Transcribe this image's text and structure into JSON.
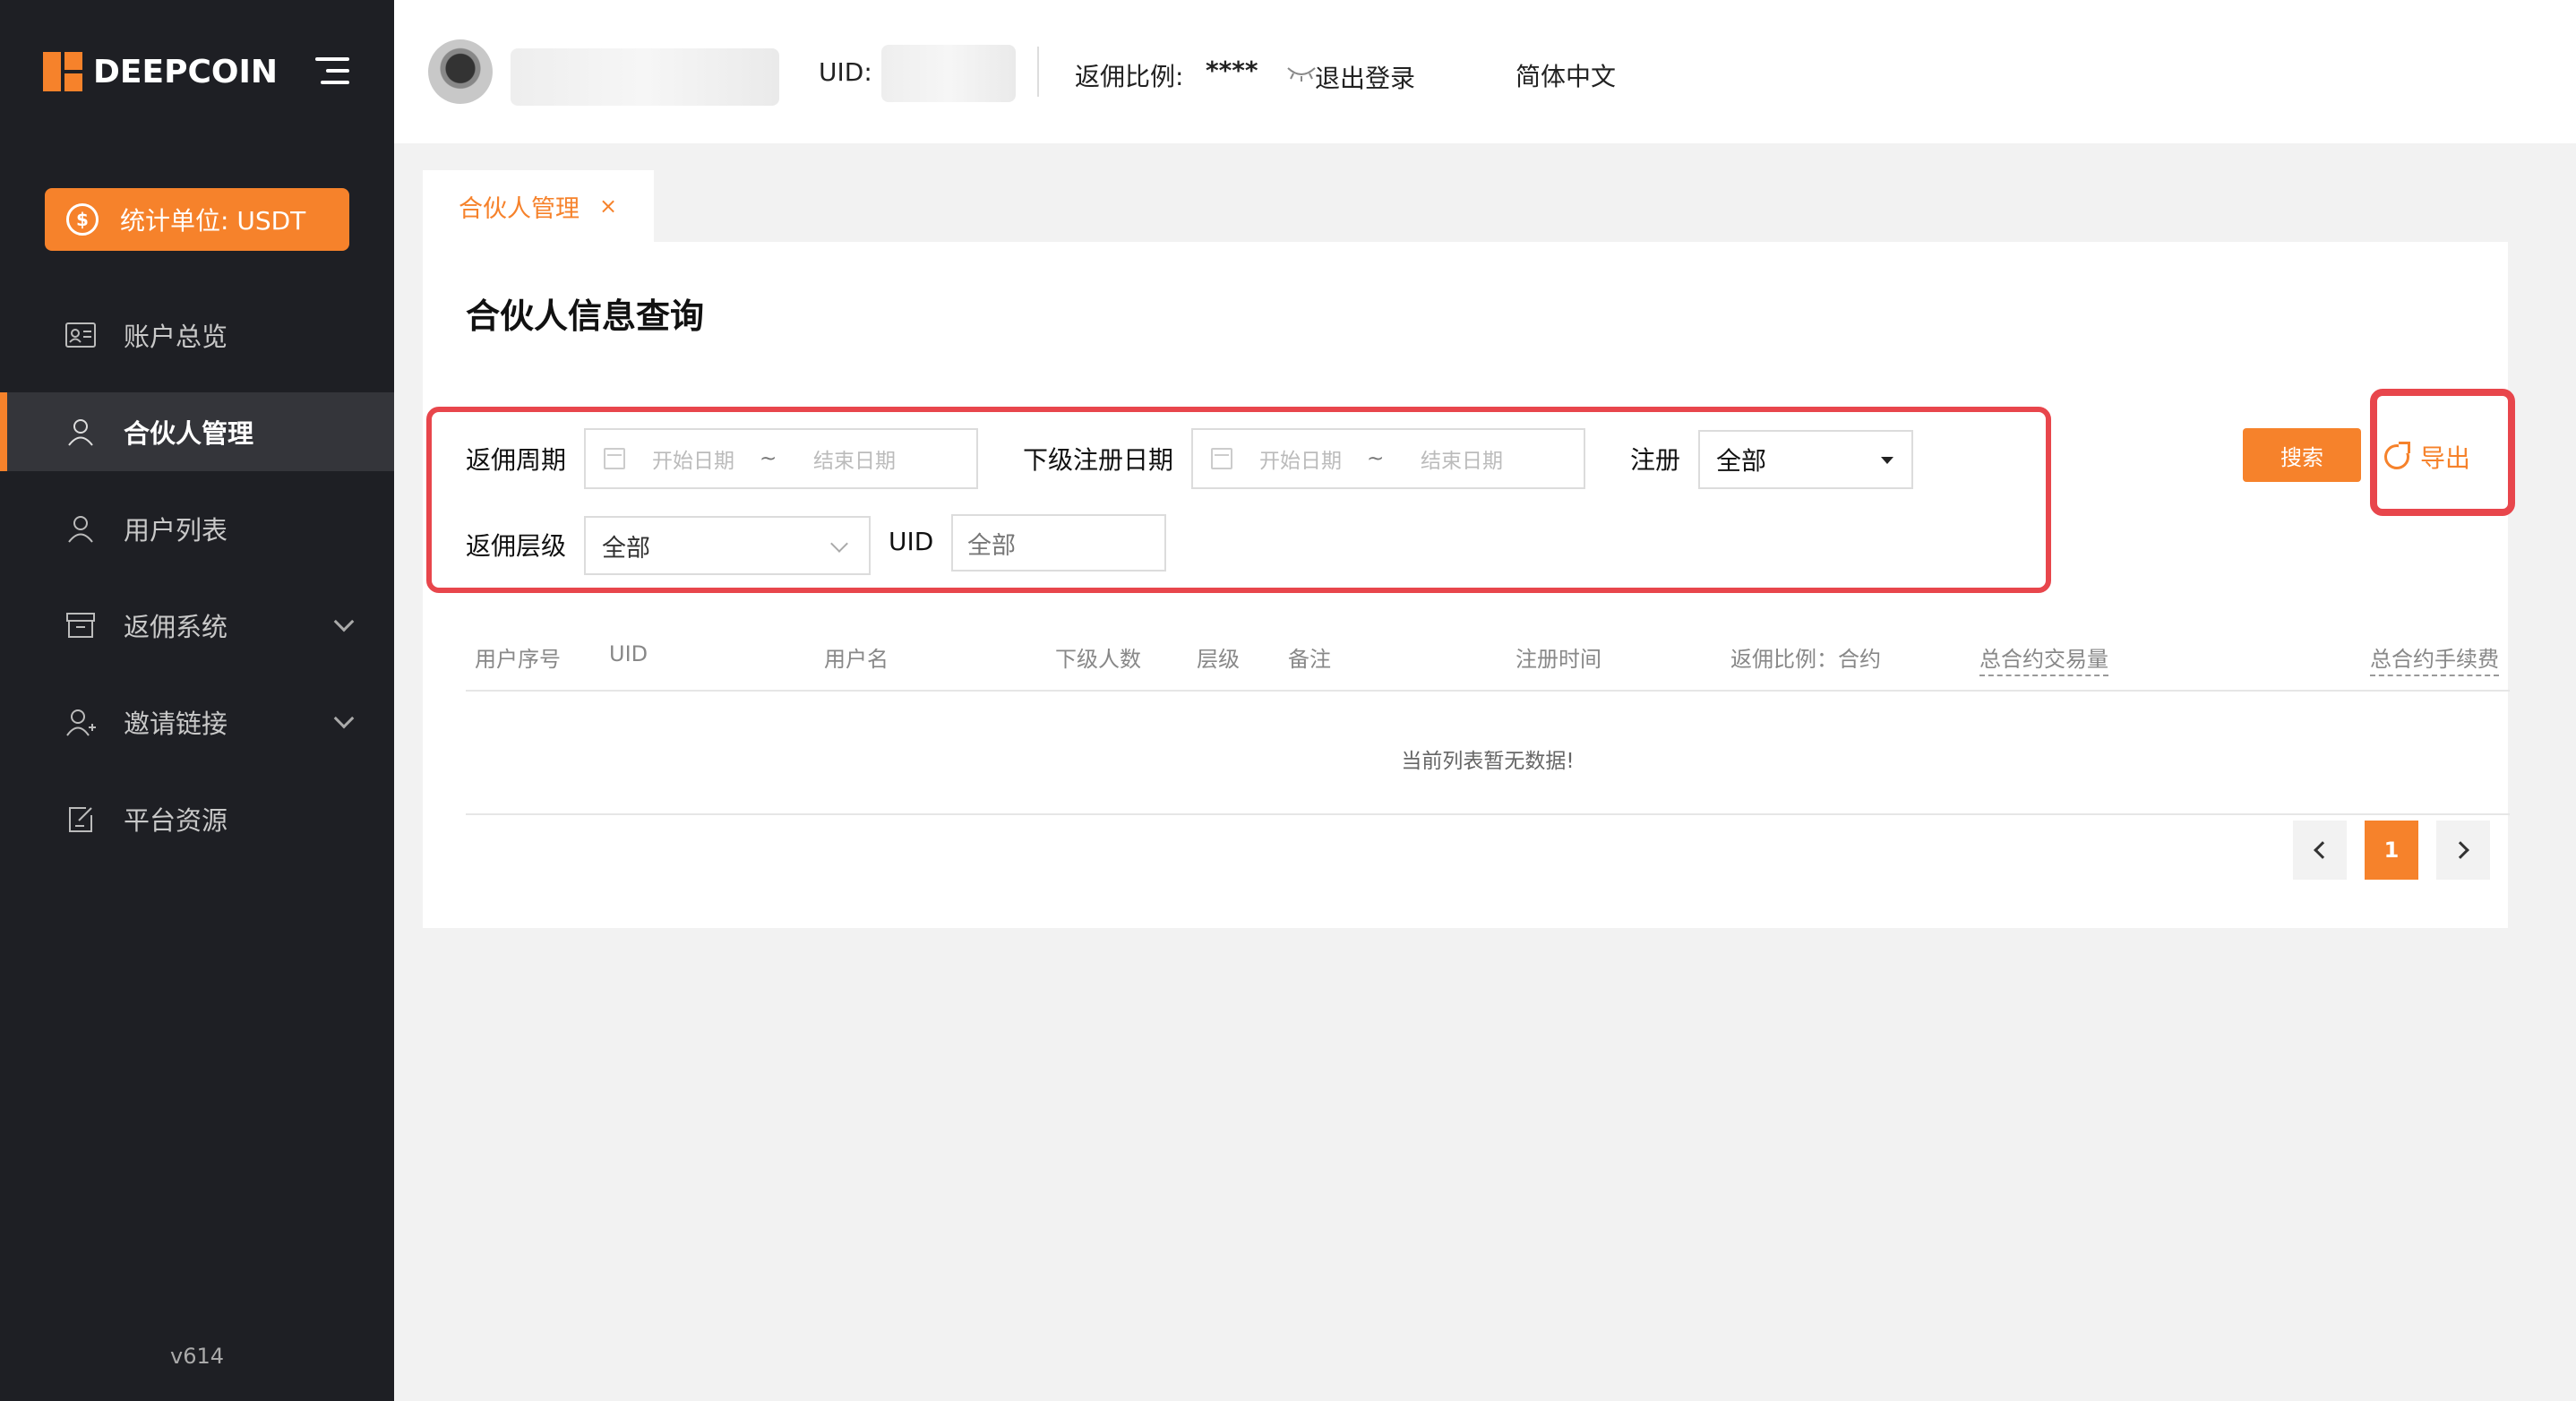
{
  "brand": {
    "name": "DEEPCOIN",
    "accent": "#f6822b"
  },
  "sidebar": {
    "unit_button": "统计单位: USDT",
    "items": [
      {
        "label": "账户总览",
        "icon": "id-card-icon"
      },
      {
        "label": "合伙人管理",
        "icon": "user-icon",
        "active": true
      },
      {
        "label": "用户列表",
        "icon": "user-icon"
      },
      {
        "label": "返佣系统",
        "icon": "box-icon",
        "expandable": true
      },
      {
        "label": "邀请链接",
        "icon": "user-add-icon",
        "expandable": true
      },
      {
        "label": "平台资源",
        "icon": "edit-doc-icon"
      }
    ],
    "version": "v614"
  },
  "header": {
    "uid_label": "UID:",
    "ratio_label": "返佣比例:",
    "ratio_value": "****",
    "logout": "退出登录",
    "language": "简体中文"
  },
  "tabs": [
    {
      "label": "合伙人管理",
      "close": "×"
    }
  ],
  "page": {
    "title": "合伙人信息查询"
  },
  "filters": {
    "period_label": "返佣周期",
    "period_start_placeholder": "开始日期",
    "period_sep": "~",
    "period_end_placeholder": "结束日期",
    "reg_date_label": "下级注册日期",
    "reg_start_placeholder": "开始日期",
    "reg_sep": "~",
    "reg_end_placeholder": "结束日期",
    "register_label": "注册",
    "register_value": "全部",
    "level_label": "返佣层级",
    "level_value": "全部",
    "uid_label": "UID",
    "uid_placeholder": "全部"
  },
  "actions": {
    "search": "搜索",
    "export": "导出"
  },
  "table": {
    "columns": [
      "用户序号",
      "UID",
      "用户名",
      "下级人数",
      "层级",
      "备注",
      "注册时间",
      "返佣比例：合约",
      "总合约交易量",
      "总合约手续费"
    ],
    "empty_text": "当前列表暂无数据!"
  },
  "pagination": {
    "current": "1"
  }
}
